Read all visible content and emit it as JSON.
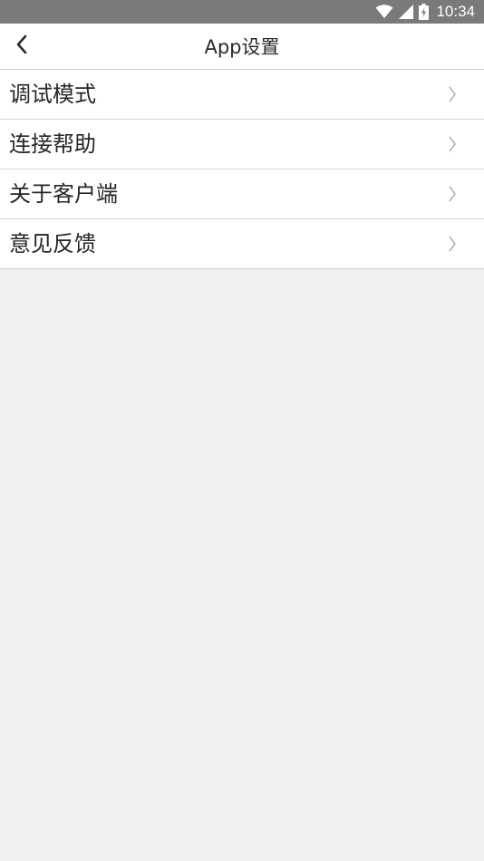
{
  "status_bar": {
    "time": "10:34",
    "icons": [
      "wifi-icon",
      "cell-signal-icon",
      "battery-charging-icon"
    ]
  },
  "header": {
    "title": "App设置",
    "back_icon": "back-arrow-icon"
  },
  "menu": {
    "items": [
      {
        "label": "调试模式",
        "icon": "chevron-right-icon"
      },
      {
        "label": "连接帮助",
        "icon": "chevron-right-icon"
      },
      {
        "label": "关于客户端",
        "icon": "chevron-right-icon"
      },
      {
        "label": "意见反馈",
        "icon": "chevron-right-icon"
      }
    ]
  },
  "colors": {
    "status_bar": "#7a7a7a",
    "background": "#efefef",
    "surface": "#ffffff",
    "divider": "#d6d6d6",
    "text": "#262626",
    "chevron": "#9a9a9a"
  }
}
